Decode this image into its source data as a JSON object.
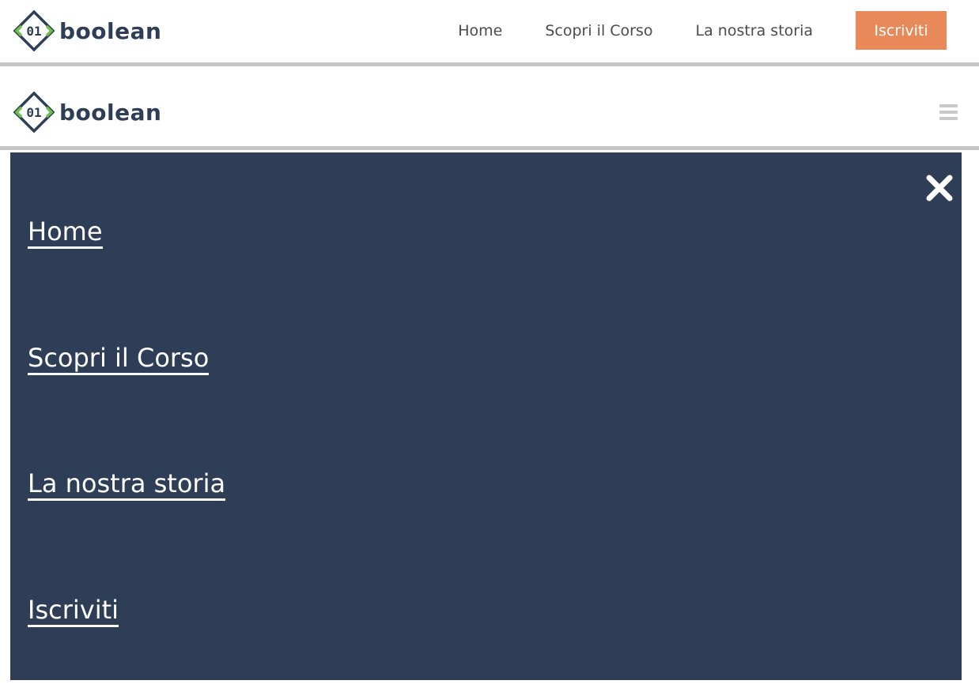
{
  "brand": {
    "name": "boolean",
    "mark": "01"
  },
  "desktop_nav": {
    "items": [
      "Home",
      "Scopri il Corso",
      "La nostra storia"
    ],
    "cta": "Iscriviti"
  },
  "mobile_menu": {
    "items": [
      "Home",
      "Scopri il Corso",
      "La nostra storia",
      "Iscriviti"
    ]
  },
  "colors": {
    "navy": "#2d3e56",
    "accent_orange": "#e8895a",
    "logo_green": "#6cc04a",
    "divider_gray": "#c6c6c6"
  },
  "icons": [
    "hamburger-icon",
    "close-icon"
  ]
}
